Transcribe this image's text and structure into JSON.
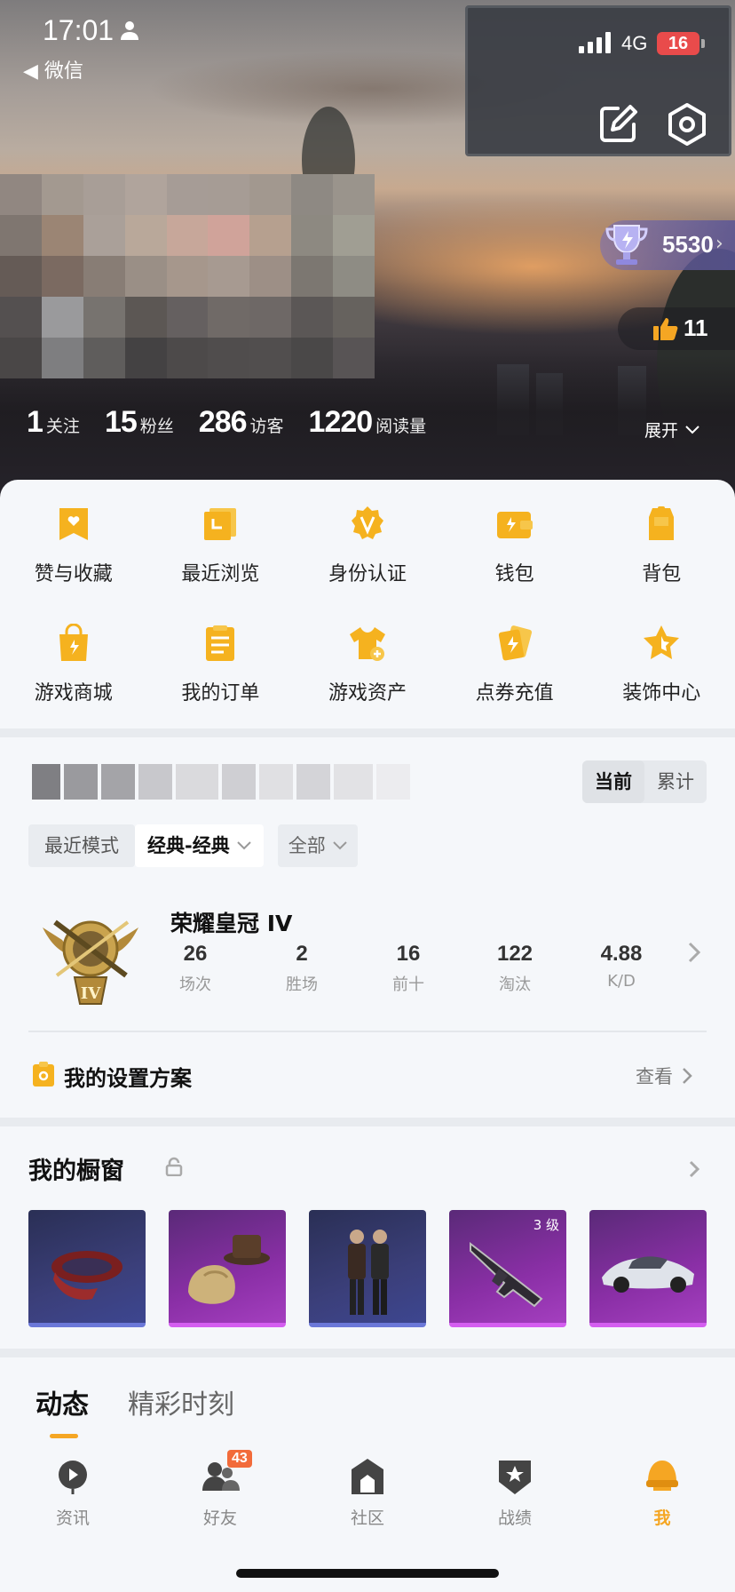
{
  "status_bar": {
    "time": "17:01",
    "back_app": "微信",
    "network": "4G",
    "battery": "16"
  },
  "profile": {
    "trophy_points": "5530",
    "likes": "11",
    "stats": [
      {
        "value": "1",
        "label": "关注"
      },
      {
        "value": "15",
        "label": "粉丝"
      },
      {
        "value": "286",
        "label": "访客"
      },
      {
        "value": "1220",
        "label": "阅读量"
      }
    ],
    "expand_label": "展开"
  },
  "shortcuts": [
    {
      "label": "赞与收藏",
      "icon": "bookmark-heart-icon"
    },
    {
      "label": "最近浏览",
      "icon": "recent-view-icon"
    },
    {
      "label": "身份认证",
      "icon": "verify-badge-icon"
    },
    {
      "label": "钱包",
      "icon": "wallet-icon"
    },
    {
      "label": "背包",
      "icon": "backpack-icon"
    },
    {
      "label": "游戏商城",
      "icon": "shop-bag-icon"
    },
    {
      "label": "我的订单",
      "icon": "order-list-icon"
    },
    {
      "label": "游戏资产",
      "icon": "tshirt-icon"
    },
    {
      "label": "点券充值",
      "icon": "voucher-icon"
    },
    {
      "label": "装饰中心",
      "icon": "star-decor-icon"
    }
  ],
  "rank_card": {
    "segment": {
      "current": "当前",
      "cumulative": "累计"
    },
    "modes": {
      "label": "最近模式",
      "selected": "经典-经典",
      "filter": "全部"
    },
    "tier": "荣耀皇冠 IV",
    "stats": [
      {
        "value": "26",
        "label": "场次"
      },
      {
        "value": "2",
        "label": "胜场"
      },
      {
        "value": "16",
        "label": "前十"
      },
      {
        "value": "122",
        "label": "淘汰"
      },
      {
        "value": "4.88",
        "label": "K/D"
      }
    ],
    "plan_title": "我的设置方案",
    "plan_view": "查看"
  },
  "showcase": {
    "title": "我的橱窗",
    "items": [
      {
        "name": "red-scarf-item",
        "rarity": "epic"
      },
      {
        "name": "hat-gloves-item",
        "rarity": "legendary"
      },
      {
        "name": "character-duo-item",
        "rarity": "epic"
      },
      {
        "name": "rifle-item",
        "rarity": "legendary",
        "level": "3 级"
      },
      {
        "name": "sports-car-item",
        "rarity": "legendary"
      }
    ]
  },
  "feed_tabs": {
    "active": "动态",
    "other": "精彩时刻"
  },
  "nav": [
    {
      "label": "资讯",
      "icon": "news-icon"
    },
    {
      "label": "好友",
      "icon": "friends-icon",
      "badge": "43"
    },
    {
      "label": "社区",
      "icon": "community-icon"
    },
    {
      "label": "战绩",
      "icon": "record-icon"
    },
    {
      "label": "我",
      "icon": "helmet-icon",
      "active": true
    }
  ],
  "colors": {
    "accent": "#f5a623",
    "epic": "#6b78d8",
    "legendary": "#d45ef0",
    "badge": "#f26b3a"
  }
}
